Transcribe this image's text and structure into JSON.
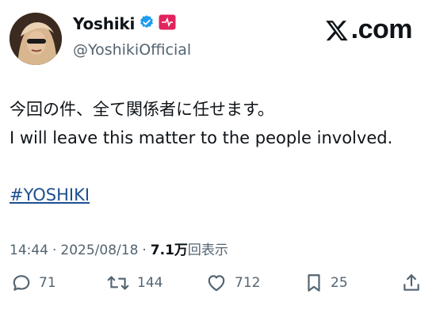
{
  "author": {
    "display_name": "Yoshiki",
    "handle": "@YoshikiOfficial",
    "verified": true
  },
  "site_label": ".com",
  "tweet": {
    "line1": "今回の件、全て関係者に任せます。",
    "line2": "I will leave this matter to the people involved.",
    "hashtag": "#YOSHIKI"
  },
  "meta": {
    "time": "14:44",
    "date": "2025/08/18",
    "views_count": "7.1万",
    "views_label": "回表示"
  },
  "actions": {
    "replies": "71",
    "reposts": "144",
    "likes": "712",
    "bookmarks": "25"
  },
  "colors": {
    "verified_badge": "#1d9bf0",
    "flag_badge": "#e0245e",
    "hashtag": "#1d4f91",
    "muted": "#536471"
  }
}
